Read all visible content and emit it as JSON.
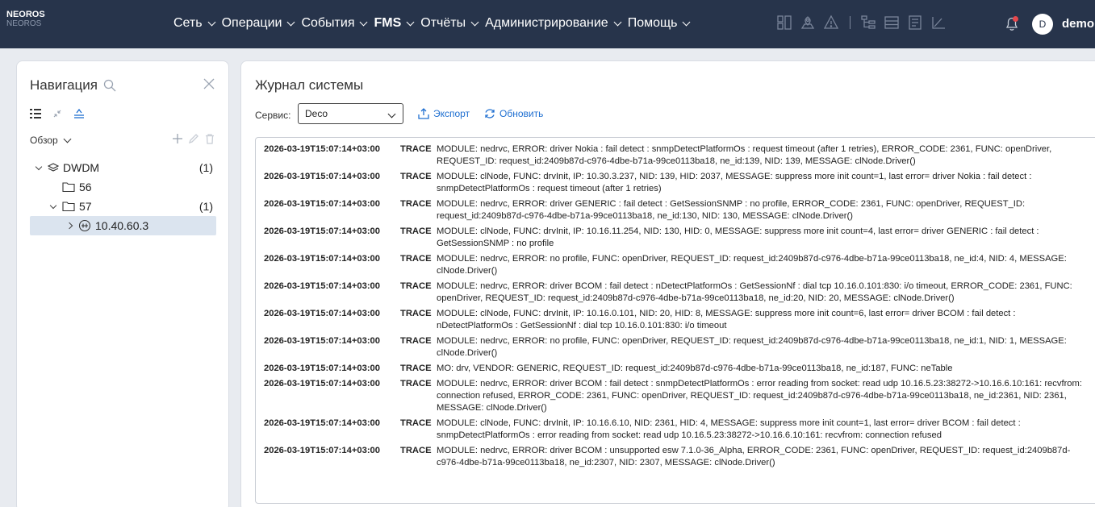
{
  "app": {
    "logo_line1": "NEOROS",
    "logo_line2": "NEOROS"
  },
  "menu": [
    {
      "label": "Сеть",
      "bold": false
    },
    {
      "label": "Операции",
      "bold": false
    },
    {
      "label": "События",
      "bold": false
    },
    {
      "label": "FMS",
      "bold": true
    },
    {
      "label": "Отчёты",
      "bold": false
    },
    {
      "label": "Администрирование",
      "bold": false
    },
    {
      "label": "Помощь",
      "bold": false
    }
  ],
  "user": {
    "initial": "D",
    "name": "demo"
  },
  "colors": {
    "topbar": "#27344b",
    "accent": "#1f6fd1",
    "alert": "#e5484d",
    "selected": "#dbe4ef"
  },
  "nav": {
    "title": "Навигация",
    "overview": "Обзор",
    "tree": [
      {
        "label": "DWDM",
        "count": "(1)",
        "icon": "layers-icon",
        "expanded": true,
        "level": 0
      },
      {
        "label": "56",
        "count": "",
        "icon": "folder-icon",
        "expanded": false,
        "level": 1
      },
      {
        "label": "57",
        "count": "(1)",
        "icon": "folder-icon",
        "expanded": true,
        "level": 1
      },
      {
        "label": "10.40.60.3",
        "count": "",
        "icon": "device-icon",
        "expanded": false,
        "level": 2,
        "selected": true
      }
    ]
  },
  "log": {
    "title": "Журнал системы",
    "service_label": "Сервис:",
    "service_value": "Deco",
    "export_label": "Экспорт",
    "refresh_label": "Обновить",
    "entries": [
      {
        "ts": "2026-03-19T15:07:14+03:00",
        "level": "TRACE",
        "msg": "MODULE: nedrvc, ERROR: driver Nokia : fail detect : snmpDetectPlatformOs : request timeout (after 1 retries), ERROR_CODE: 2361, FUNC: openDriver, REQUEST_ID: request_id:2409b87d-c976-4dbe-b71a-99ce0113ba18, ne_id:139, NID: 139, MESSAGE: clNode.Driver()"
      },
      {
        "ts": "2026-03-19T15:07:14+03:00",
        "level": "TRACE",
        "msg": "MODULE: clNode, FUNC: drvInit, IP: 10.30.3.237, NID: 139, HID: 2037, MESSAGE: suppress more init count=1, last error= driver Nokia : fail detect : snmpDetectPlatformOs : request timeout (after 1 retries)"
      },
      {
        "ts": "2026-03-19T15:07:14+03:00",
        "level": "TRACE",
        "msg": "MODULE: nedrvc, ERROR: driver GENERIC : fail detect : GetSessionSNMP : no profile, ERROR_CODE: 2361, FUNC: openDriver, REQUEST_ID: request_id:2409b87d-c976-4dbe-b71a-99ce0113ba18, ne_id:130, NID: 130, MESSAGE: clNode.Driver()"
      },
      {
        "ts": "2026-03-19T15:07:14+03:00",
        "level": "TRACE",
        "msg": "MODULE: clNode, FUNC: drvInit, IP: 10.16.11.254, NID: 130, HID: 0, MESSAGE: suppress more init count=4, last error= driver GENERIC : fail detect : GetSessionSNMP : no profile"
      },
      {
        "ts": "2026-03-19T15:07:14+03:00",
        "level": "TRACE",
        "msg": "MODULE: nedrvc, ERROR: no profile, FUNC: openDriver, REQUEST_ID: request_id:2409b87d-c976-4dbe-b71a-99ce0113ba18, ne_id:4, NID: 4, MESSAGE: clNode.Driver()"
      },
      {
        "ts": "2026-03-19T15:07:14+03:00",
        "level": "TRACE",
        "msg": "MODULE: nedrvc, ERROR: driver BCOM : fail detect : nDetectPlatformOs : GetSessionNf : dial tcp 10.16.0.101:830: i/o timeout, ERROR_CODE: 2361, FUNC: openDriver, REQUEST_ID: request_id:2409b87d-c976-4dbe-b71a-99ce0113ba18, ne_id:20, NID: 20, MESSAGE: clNode.Driver()"
      },
      {
        "ts": "2026-03-19T15:07:14+03:00",
        "level": "TRACE",
        "msg": "MODULE: clNode, FUNC: drvInit, IP: 10.16.0.101, NID: 20, HID: 8, MESSAGE: suppress more init count=6, last error= driver BCOM : fail detect : nDetectPlatformOs : GetSessionNf : dial tcp 10.16.0.101:830: i/o timeout"
      },
      {
        "ts": "2026-03-19T15:07:14+03:00",
        "level": "TRACE",
        "msg": "MODULE: nedrvc, ERROR: no profile, FUNC: openDriver, REQUEST_ID: request_id:2409b87d-c976-4dbe-b71a-99ce0113ba18, ne_id:1, NID: 1, MESSAGE: clNode.Driver()"
      },
      {
        "ts": "2026-03-19T15:07:14+03:00",
        "level": "TRACE",
        "msg": "MO: drv, VENDOR: GENERIC, REQUEST_ID: request_id:2409b87d-c976-4dbe-b71a-99ce0113ba18, ne_id:187, FUNC: neTable"
      },
      {
        "ts": "2026-03-19T15:07:14+03:00",
        "level": "TRACE",
        "msg": "MODULE: nedrvc, ERROR: driver BCOM : fail detect : snmpDetectPlatformOs : error reading from socket: read udp 10.16.5.23:38272->10.16.6.10:161: recvfrom: connection refused, ERROR_CODE: 2361, FUNC: openDriver, REQUEST_ID: request_id:2409b87d-c976-4dbe-b71a-99ce0113ba18, ne_id:2361, NID: 2361, MESSAGE: clNode.Driver()"
      },
      {
        "ts": "2026-03-19T15:07:14+03:00",
        "level": "TRACE",
        "msg": "MODULE: clNode, FUNC: drvInit, IP: 10.16.6.10, NID: 2361, HID: 4, MESSAGE: suppress more init count=1, last error= driver BCOM : fail detect : snmpDetectPlatformOs : error reading from socket: read udp 10.16.5.23:38272->10.16.6.10:161: recvfrom: connection refused"
      },
      {
        "ts": "2026-03-19T15:07:14+03:00",
        "level": "TRACE",
        "msg": "MODULE: nedrvc, ERROR: driver BCOM : unsupported esw 7.1.0-36_Alpha, ERROR_CODE: 2361, FUNC: openDriver, REQUEST_ID: request_id:2409b87d-c976-4dbe-b71a-99ce0113ba18, ne_id:2307, NID: 2307, MESSAGE: clNode.Driver()"
      }
    ]
  }
}
